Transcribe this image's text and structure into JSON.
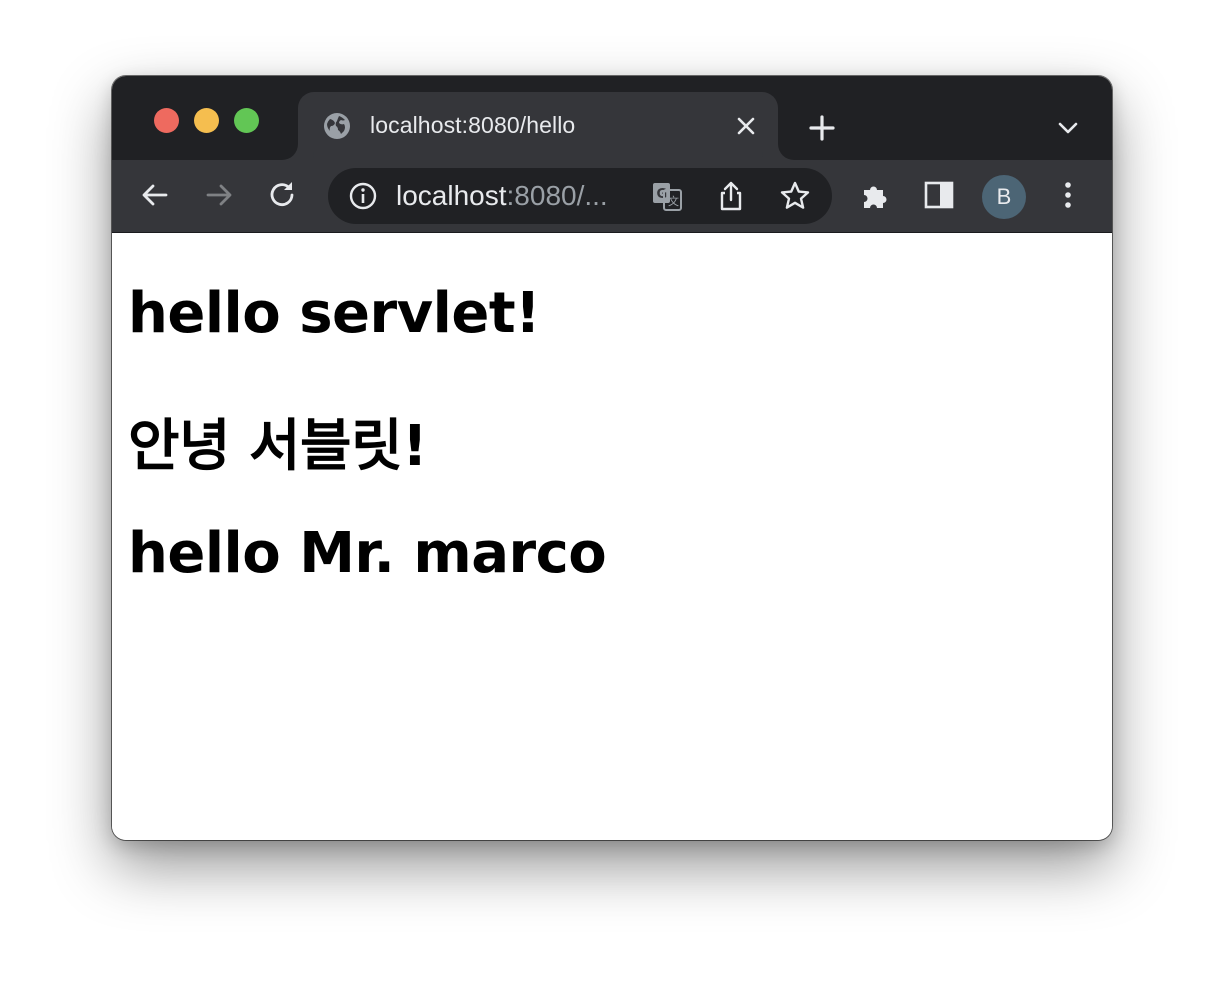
{
  "browser": {
    "tab": {
      "title": "localhost:8080/hello"
    },
    "omnibox": {
      "host": "localhost",
      "rest": ":8080/..."
    },
    "profile_initial": "B",
    "icons": {
      "traffic_lights": [
        "close-dot",
        "minimize-dot",
        "zoom-dot"
      ],
      "tab_favicon": "globe-icon",
      "tab_close": "close-icon",
      "new_tab": "plus-icon",
      "tab_search": "chevron-down-icon",
      "back": "arrow-left-icon",
      "forward": "arrow-right-icon",
      "reload": "reload-icon",
      "site_info": "info-icon",
      "translate": "translate-icon",
      "share": "share-icon",
      "bookmark": "star-icon",
      "extensions": "puzzle-icon",
      "side_panel": "side-panel-icon",
      "menu": "kebab-menu-icon"
    },
    "colors": {
      "tabstrip": "#202124",
      "toolbar": "#35363a",
      "omnibox": "#202124",
      "avatar": "#4c6575",
      "red": "#ee6a5f",
      "yellow": "#f5be4f",
      "green": "#62c655"
    }
  },
  "page": {
    "headings": [
      "hello servlet!",
      "안녕 서블릿!",
      "hello Mr. marco"
    ]
  }
}
